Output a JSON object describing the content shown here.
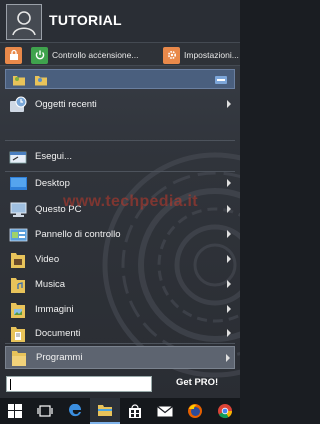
{
  "header": {
    "username": "TUTORIAL"
  },
  "quick": {
    "power_label": "Controllo accensione...",
    "settings_label": "Impostazioni..."
  },
  "menu": {
    "recent": "Oggetti recenti",
    "run": "Esegui...",
    "items": [
      {
        "label": "Desktop",
        "icon": "desktop-icon",
        "submenu": true
      },
      {
        "label": "Questo PC",
        "icon": "computer-icon",
        "submenu": true
      },
      {
        "label": "Pannello di controllo",
        "icon": "control-panel-icon",
        "submenu": true
      },
      {
        "label": "Video",
        "icon": "video-folder-icon",
        "submenu": true
      },
      {
        "label": "Musica",
        "icon": "music-folder-icon",
        "submenu": true
      },
      {
        "label": "Immagini",
        "icon": "pictures-folder-icon",
        "submenu": true
      },
      {
        "label": "Documenti",
        "icon": "documents-folder-icon",
        "submenu": true
      },
      {
        "label": "Programmi",
        "icon": "programs-folder-icon",
        "submenu": true,
        "selected": true
      }
    ]
  },
  "search": {
    "value": "",
    "get_pro": "Get PRO!"
  },
  "taskbar": {
    "icons": [
      "windows-start-icon",
      "task-view-icon",
      "edge-icon",
      "file-explorer-icon",
      "store-icon",
      "mail-icon",
      "firefox-icon",
      "chrome-icon"
    ],
    "active": "file-explorer-icon"
  },
  "watermark": "www.techpedia.it",
  "colors": {
    "accent": "#4a5f7e",
    "selection": "#5d6470",
    "watermark": "#c0392b"
  }
}
